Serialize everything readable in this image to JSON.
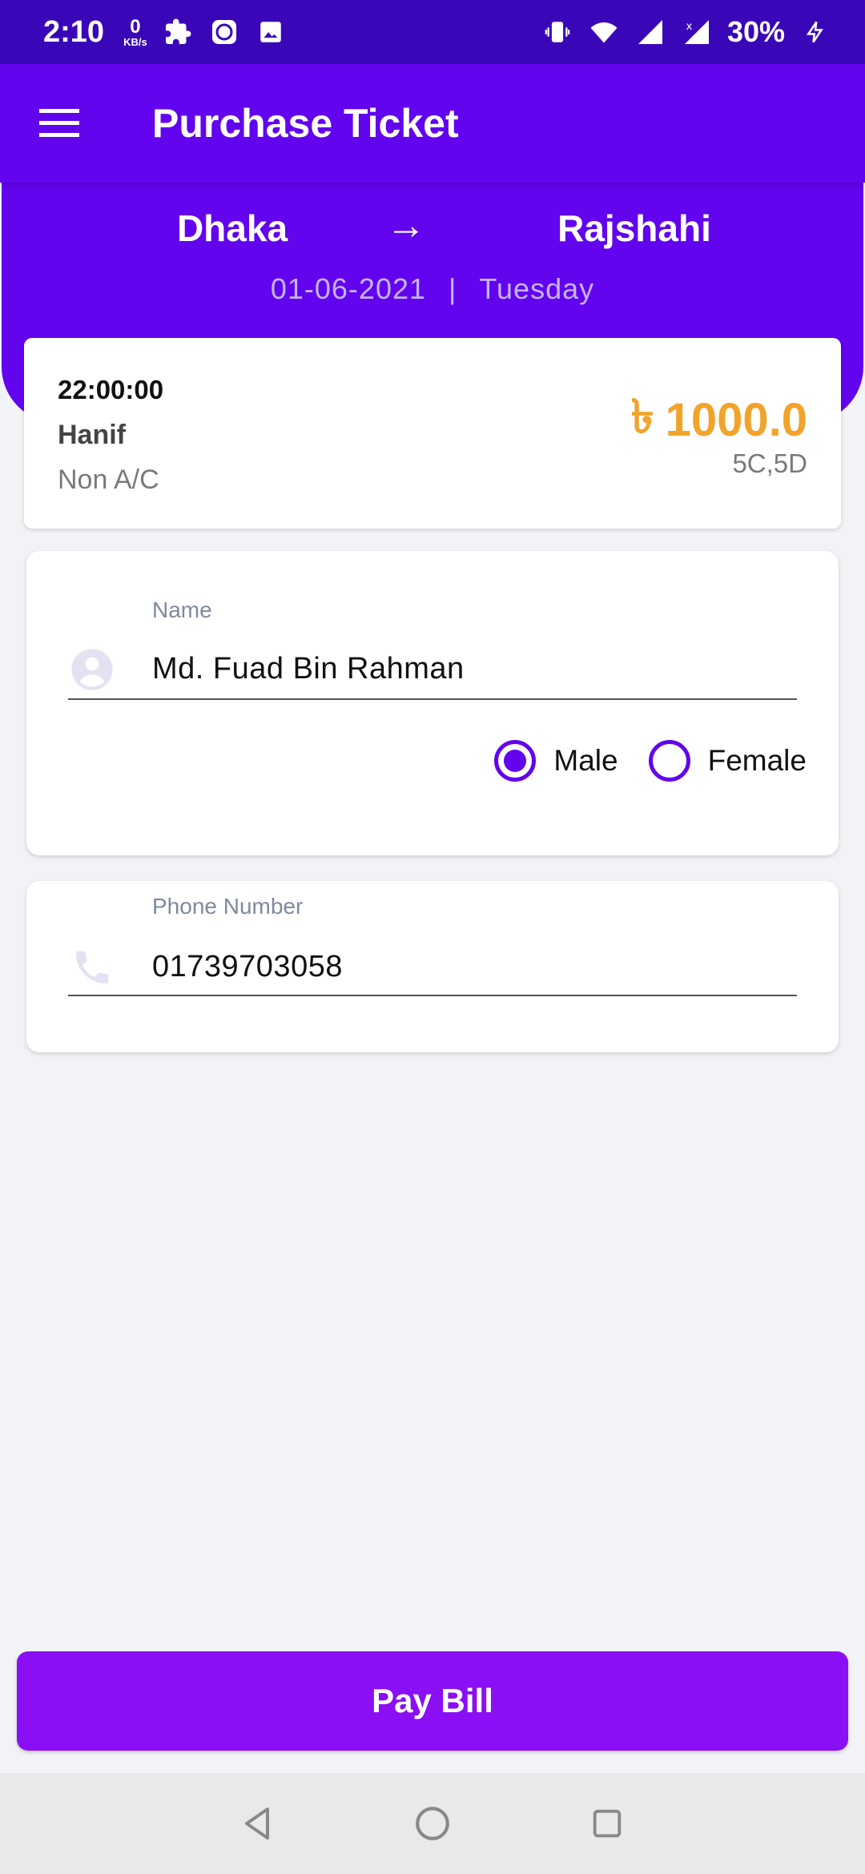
{
  "status_bar": {
    "time": "2:10",
    "speed_value": "0",
    "speed_unit": "KB/s",
    "battery": "30%",
    "icons": [
      "puzzle-icon",
      "app-icon",
      "image-icon",
      "vibrate-icon",
      "wifi-icon",
      "signal-icon",
      "signal-x-icon",
      "charging-icon"
    ]
  },
  "app_bar": {
    "title": "Purchase Ticket",
    "menu_icon": "hamburger-menu-icon"
  },
  "route": {
    "from": "Dhaka",
    "arrow": "→",
    "to": "Rajshahi",
    "date": "01-06-2021",
    "separator": "|",
    "day": "Tuesday"
  },
  "trip": {
    "time": "22:00:00",
    "operator": "Hanif",
    "class": "Non A/C",
    "currency_symbol": "৳",
    "price": "1000.0",
    "seats": "5C,5D"
  },
  "name_field": {
    "label": "Name",
    "value": "Md. Fuad Bin Rahman",
    "icon": "person-icon"
  },
  "gender": {
    "options": [
      {
        "label": "Male",
        "selected": true
      },
      {
        "label": "Female",
        "selected": false
      }
    ]
  },
  "phone_field": {
    "label": "Phone Number",
    "value": "01739703058",
    "icon": "phone-icon"
  },
  "pay_button": {
    "label": "Pay Bill"
  },
  "colors": {
    "primary": "#6204ee",
    "status_bar": "#3a07b8",
    "price": "#f2a32a",
    "button": "#8a0ff5"
  }
}
